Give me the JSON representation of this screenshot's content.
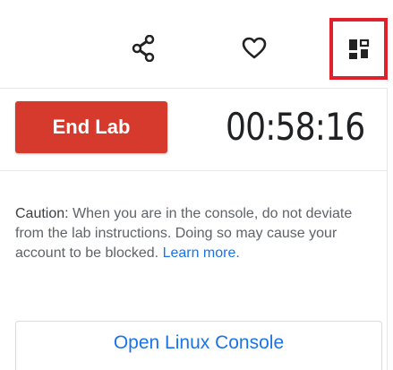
{
  "toolbar": {
    "share_icon": "share-icon",
    "favorite_icon": "heart-icon",
    "layout_icon": "dashboard-layout-icon",
    "highlight_color": "#e0202b"
  },
  "lab": {
    "end_label": "End Lab",
    "end_color": "#d63a2c",
    "timer": "00:58:16"
  },
  "caution": {
    "label": "Caution:",
    "text": " When you are in the console, do not deviate from the lab instructions. Doing so may cause your account to be blocked. ",
    "link": "Learn more."
  },
  "console": {
    "open_label": "Open Linux Console",
    "link_color": "#1a73e8"
  }
}
